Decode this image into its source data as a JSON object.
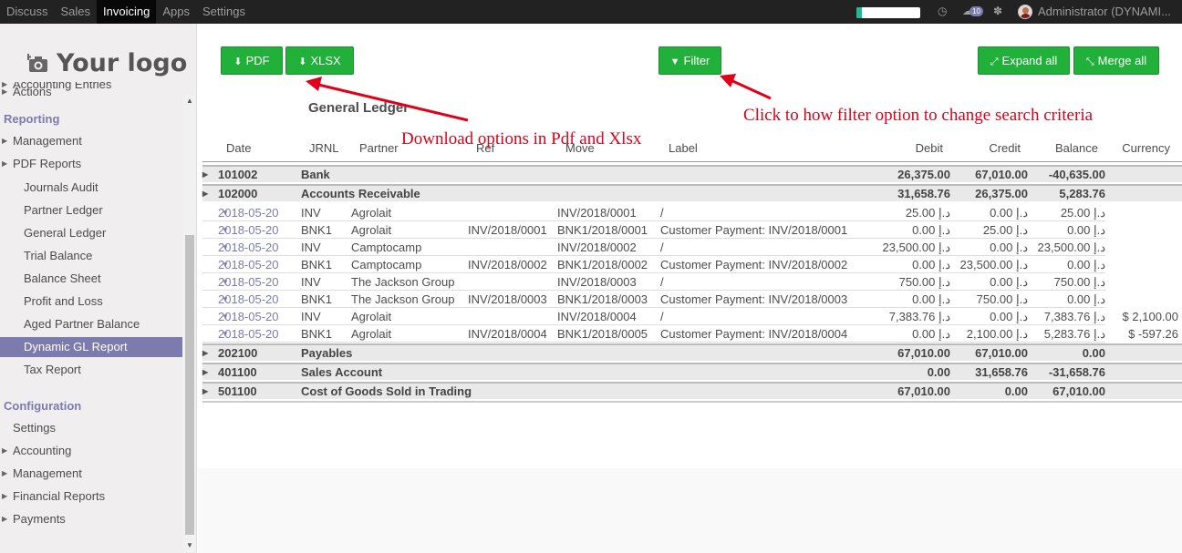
{
  "topbar": {
    "menu": [
      "Discuss",
      "Sales",
      "Invoicing",
      "Apps",
      "Settings"
    ],
    "active_index": 2,
    "progress_fraction": 0.08,
    "messages_badge": "10",
    "user": "Administrator (DYNAMI..."
  },
  "sidebar": {
    "logo_text": "Your logo",
    "items": [
      {
        "label": "Accounting Entries",
        "kind": "lvl1",
        "caret": true
      },
      {
        "label": "Actions",
        "kind": "lvl1",
        "caret": true
      },
      {
        "label": "Reporting",
        "kind": "head"
      },
      {
        "label": "Management",
        "kind": "lvl1",
        "caret": true
      },
      {
        "label": "PDF Reports",
        "kind": "lvl1",
        "caret": true
      },
      {
        "label": "Journals Audit",
        "kind": "lvl2"
      },
      {
        "label": "Partner Ledger",
        "kind": "lvl2"
      },
      {
        "label": "General Ledger",
        "kind": "lvl2"
      },
      {
        "label": "Trial Balance",
        "kind": "lvl2"
      },
      {
        "label": "Balance Sheet",
        "kind": "lvl2"
      },
      {
        "label": "Profit and Loss",
        "kind": "lvl2"
      },
      {
        "label": "Aged Partner Balance",
        "kind": "lvl2"
      },
      {
        "label": "Dynamic GL Report",
        "kind": "lvl2",
        "selected": true
      },
      {
        "label": "Tax Report",
        "kind": "lvl2"
      },
      {
        "label": "Configuration",
        "kind": "head"
      },
      {
        "label": "Settings",
        "kind": "lvl1"
      },
      {
        "label": "Accounting",
        "kind": "lvl1",
        "caret": true
      },
      {
        "label": "Management",
        "kind": "lvl1",
        "caret": true
      },
      {
        "label": "Financial Reports",
        "kind": "lvl1",
        "caret": true
      },
      {
        "label": "Payments",
        "kind": "lvl1",
        "caret": true
      }
    ]
  },
  "toolbar": {
    "pdf_label": "PDF",
    "xlsx_label": "XLSX",
    "filter_label": "Filter",
    "expand_label": "Expand all",
    "merge_label": "Merge all"
  },
  "report": {
    "title": "General Ledger",
    "annotation_download": "Download options in Pdf and Xlsx",
    "annotation_filter": "Click to how filter option to change search criteria",
    "columns": [
      "Date",
      "JRNL",
      "Partner",
      "Ref",
      "Move",
      "Label",
      "Debit",
      "Credit",
      "Balance",
      "Currency"
    ],
    "groups": [
      {
        "code": "101002",
        "name": "Bank",
        "debit": "26,375.00",
        "credit": "67,010.00",
        "balance": "-40,635.00"
      },
      {
        "code": "102000",
        "name": "Accounts Receivable",
        "debit": "31,658.76",
        "credit": "26,375.00",
        "balance": "5,283.76"
      },
      {
        "code": "202100",
        "name": "Payables",
        "debit": "67,010.00",
        "credit": "67,010.00",
        "balance": "0.00"
      },
      {
        "code": "401100",
        "name": "Sales Account",
        "debit": "0.00",
        "credit": "31,658.76",
        "balance": "-31,658.76"
      },
      {
        "code": "501100",
        "name": "Cost of Goods Sold in Trading",
        "debit": "67,010.00",
        "credit": "0.00",
        "balance": "67,010.00"
      }
    ],
    "lines": [
      {
        "date": "2018-05-20",
        "jrnl": "INV",
        "partner": "Agrolait",
        "ref": "",
        "move": "INV/2018/0001",
        "label": "/",
        "debit": "25.00 د.إ",
        "credit": "0.00 د.إ",
        "balance": "25.00 د.إ",
        "currency": ""
      },
      {
        "date": "2018-05-20",
        "jrnl": "BNK1",
        "partner": "Agrolait",
        "ref": "INV/2018/0001",
        "move": "BNK1/2018/0001",
        "label": "Customer Payment: INV/2018/0001",
        "debit": "0.00 د.إ",
        "credit": "25.00 د.إ",
        "balance": "0.00 د.إ",
        "currency": ""
      },
      {
        "date": "2018-05-20",
        "jrnl": "INV",
        "partner": "Camptocamp",
        "ref": "",
        "move": "INV/2018/0002",
        "label": "/",
        "debit": "23,500.00 د.إ",
        "credit": "0.00 د.إ",
        "balance": "23,500.00 د.إ",
        "currency": ""
      },
      {
        "date": "2018-05-20",
        "jrnl": "BNK1",
        "partner": "Camptocamp",
        "ref": "INV/2018/0002",
        "move": "BNK1/2018/0002",
        "label": "Customer Payment: INV/2018/0002",
        "debit": "0.00 د.إ",
        "credit": "23,500.00 د.إ",
        "balance": "0.00 د.إ",
        "currency": ""
      },
      {
        "date": "2018-05-20",
        "jrnl": "INV",
        "partner": "The Jackson Group",
        "ref": "",
        "move": "INV/2018/0003",
        "label": "/",
        "debit": "750.00 د.إ",
        "credit": "0.00 د.إ",
        "balance": "750.00 د.إ",
        "currency": ""
      },
      {
        "date": "2018-05-20",
        "jrnl": "BNK1",
        "partner": "The Jackson Group",
        "ref": "INV/2018/0003",
        "move": "BNK1/2018/0003",
        "label": "Customer Payment: INV/2018/0003",
        "debit": "0.00 د.إ",
        "credit": "750.00 د.إ",
        "balance": "0.00 د.إ",
        "currency": ""
      },
      {
        "date": "2018-05-20",
        "jrnl": "INV",
        "partner": "Agrolait",
        "ref": "",
        "move": "INV/2018/0004",
        "label": "/",
        "debit": "7,383.76 د.إ",
        "credit": "0.00 د.إ",
        "balance": "7,383.76 د.إ",
        "currency": "$ 2,100.00"
      },
      {
        "date": "2018-05-20",
        "jrnl": "BNK1",
        "partner": "Agrolait",
        "ref": "INV/2018/0004",
        "move": "BNK1/2018/0005",
        "label": "Customer Payment: INV/2018/0004",
        "debit": "0.00 د.إ",
        "credit": "2,100.00 د.إ",
        "balance": "5,283.76 د.إ",
        "currency": "$ -597.26"
      }
    ]
  }
}
